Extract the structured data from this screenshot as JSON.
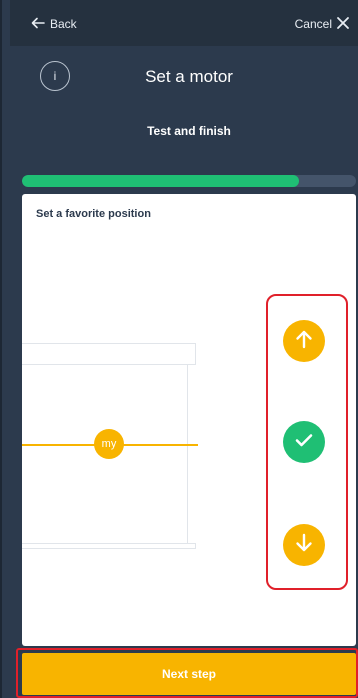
{
  "topbar": {
    "back_label": "Back",
    "cancel_label": "Cancel"
  },
  "header": {
    "info_label": "i",
    "title": "Set a motor",
    "subtitle": "Test and finish"
  },
  "progress": {
    "fraction": 0.83
  },
  "card": {
    "title": "Set a favorite position",
    "my_label": "my"
  },
  "controls": {
    "up_icon": "arrow-up-icon",
    "confirm_icon": "check-icon",
    "down_icon": "arrow-down-icon"
  },
  "footer": {
    "next_label": "Next step"
  },
  "colors": {
    "background": "#2c3a4d",
    "accent_yellow": "#f8b400",
    "accent_green": "#1fbf74",
    "highlight_red": "#e0202a"
  }
}
